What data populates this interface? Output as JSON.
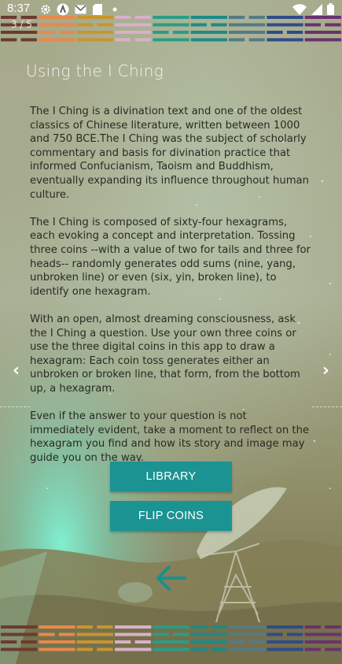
{
  "status_bar": {
    "time": "8:37",
    "icons": [
      "settings-icon",
      "a-icon",
      "gmail-icon",
      "sd-card-icon",
      "dot-icon"
    ],
    "right_icons": [
      "wifi-icon",
      "signal-icon",
      "battery-icon"
    ]
  },
  "page_counter": "3 / 5",
  "title": "Using the I Ching",
  "paragraphs": [
    "The I Ching is a divination text and one of the oldest classics of Chinese literature, written between 1000 and 750 BCE.The I Ching was the subject of scholarly commentary and basis for divination practice that informed Confucianism, Taoism and Buddhism, eventually expanding its influence throughout human culture.",
    "The I Ching is composed of sixty-four hexagrams, each evoking a concept and interpretation. Tossing three coins --with a value of two for tails and three for heads-- randomly generates odd sums (nine, yang, unbroken line) or even (six, yin, broken line), to identify one hexagram.",
    "With an open, almost dreaming consciousness, ask the I Ching a question. Use your own three coins or use the three digital coins in this app to draw a hexagram: Each coin toss generates either an unbroken or broken line, that form, from the bottom up, a hexagram.",
    "Even if the answer to your question is not immediately evident, take a moment to reflect on the hexagram you find and how its story and image may guide you on the way."
  ],
  "buttons": {
    "library": "LIBRARY",
    "flip_coins": "FLIP COINS"
  },
  "nav": {
    "prev": "‹",
    "next": "›"
  },
  "colors": {
    "button": "#1b9392",
    "back_arrow": "#1b8f8e",
    "stripe_palette": [
      "#6b3b2f",
      "#e8894a",
      "#c9952e",
      "#d9b0c8",
      "#2a9d85",
      "#1e8a86",
      "#557a84",
      "#2f4b8a",
      "#6a3170"
    ]
  }
}
